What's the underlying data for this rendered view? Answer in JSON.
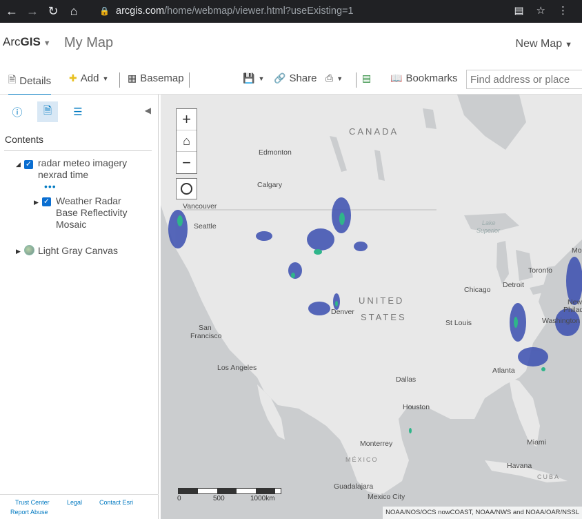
{
  "browser": {
    "url_host": "arcgis.com",
    "url_path": "/home/webmap/viewer.html?useExisting=1"
  },
  "header": {
    "brand_prefix": "Arc",
    "brand_bold": "GIS",
    "map_title": "My Map",
    "new_map_label": "New Map"
  },
  "toolbar": {
    "details": "Details",
    "add": "Add",
    "basemap": "Basemap",
    "share": "Share",
    "bookmarks": "Bookmarks",
    "search_placeholder": "Find address or place"
  },
  "panel": {
    "contents_title": "Contents",
    "layers": [
      {
        "line1": "radar meteo imagery",
        "line2": "nexrad time"
      },
      {
        "line1": "Weather Radar",
        "line2": "Base Reflectivity",
        "line3": "Mosaic"
      },
      {
        "line1": "Light Gray Canvas"
      }
    ],
    "footer": {
      "trust": "Trust Center",
      "legal": "Legal",
      "contact": "Contact Esri",
      "report": "Report Abuse"
    }
  },
  "map": {
    "labels": {
      "canada": "CANADA",
      "usa1": "UNITED",
      "usa2": "STATES",
      "mexico": "MÉXICO",
      "cuba": "CUBA",
      "lake": "Lake",
      "superior": "Superior",
      "edmonton": "Edmonton",
      "calgary": "Calgary",
      "vancouver": "Vancouver",
      "seattle": "Seattle",
      "sanfrancisco1": "San",
      "sanfrancisco2": "Francisco",
      "losangeles": "Los Angeles",
      "denver": "Denver",
      "dallas": "Dallas",
      "houston": "Houston",
      "monterrey": "Monterrey",
      "guadalajara": "Guadalajara",
      "mexicocity": "Mexico City",
      "chicago": "Chicago",
      "stlouis": "St Louis",
      "detroit": "Detroit",
      "toronto": "Toronto",
      "philadelphia": "Philade",
      "newyork": "New",
      "washington": "Washington",
      "montreal": "Mo",
      "atlanta": "Atlanta",
      "miami": "Miami",
      "havana": "Havana"
    },
    "scale": {
      "l0": "0",
      "l1": "500",
      "l2": "1000km"
    },
    "attribution": "NOAA/NOS/OCS nowCOAST, NOAA/NWS and NOAA/OAR/NSSL"
  },
  "colors": {
    "accent": "#0079c1",
    "land": "#e6e6e6",
    "water": "#cbcdcf"
  }
}
